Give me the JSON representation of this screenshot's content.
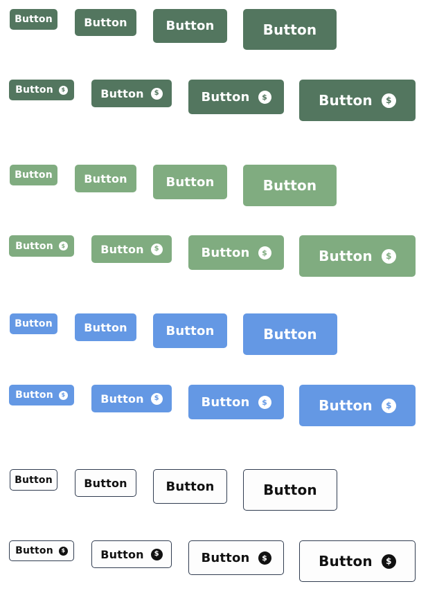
{
  "button": {
    "label": "Button"
  },
  "icon": {
    "name": "dollar-circle-icon",
    "glyph": "$"
  },
  "variants": {
    "dark": {
      "name": "dark-green",
      "color": "#53765f"
    },
    "light": {
      "name": "light-green",
      "color": "#80ac80"
    },
    "blue": {
      "name": "blue",
      "color": "#6498e4"
    },
    "out": {
      "name": "outline",
      "color": "#2f3b4f"
    }
  }
}
